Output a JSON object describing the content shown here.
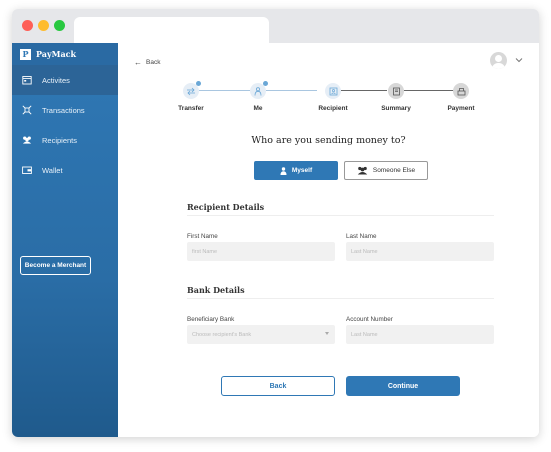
{
  "brand": {
    "name": "PayMack",
    "logo_letter": "P"
  },
  "sidebar": {
    "items": [
      {
        "label": "Activites",
        "icon": "calendar-icon",
        "active": true
      },
      {
        "label": "Transactions",
        "icon": "transfer-icon",
        "active": false
      },
      {
        "label": "Recipients",
        "icon": "users-icon",
        "active": false
      },
      {
        "label": "Wallet",
        "icon": "wallet-icon",
        "active": false
      }
    ],
    "merchant_button": "Become a Merchant"
  },
  "header": {
    "back_label": "Back",
    "avatar_icon": "user-avatar-icon",
    "menu_icon": "chevron-down-icon"
  },
  "steps": [
    {
      "label": "Transfer",
      "state": "completed"
    },
    {
      "label": "Me",
      "state": "completed"
    },
    {
      "label": "Recipient",
      "state": "current"
    },
    {
      "label": "Summary",
      "state": "pending"
    },
    {
      "label": "Payment",
      "state": "pending"
    }
  ],
  "question": "Who are you sending money to?",
  "choices": {
    "myself": "Myself",
    "someone_else": "Someone Else",
    "selected": "Myself"
  },
  "recipient_details": {
    "title": "Recipient Details",
    "first_name_label": "First Name",
    "first_name_placeholder": "first Name",
    "last_name_label": "Last Name",
    "last_name_placeholder": "Last Name"
  },
  "bank_details": {
    "title": "Bank Details",
    "bank_label": "Beneficiary Bank",
    "bank_placeholder": "Choose recipient's Bank",
    "account_label": "Account Number",
    "account_placeholder": "Last Name"
  },
  "actions": {
    "back": "Back",
    "continue": "Continue"
  },
  "colors": {
    "primary": "#2f78b5",
    "sidebar_active": "#2c6497",
    "field_bg": "#f1f1f1"
  }
}
